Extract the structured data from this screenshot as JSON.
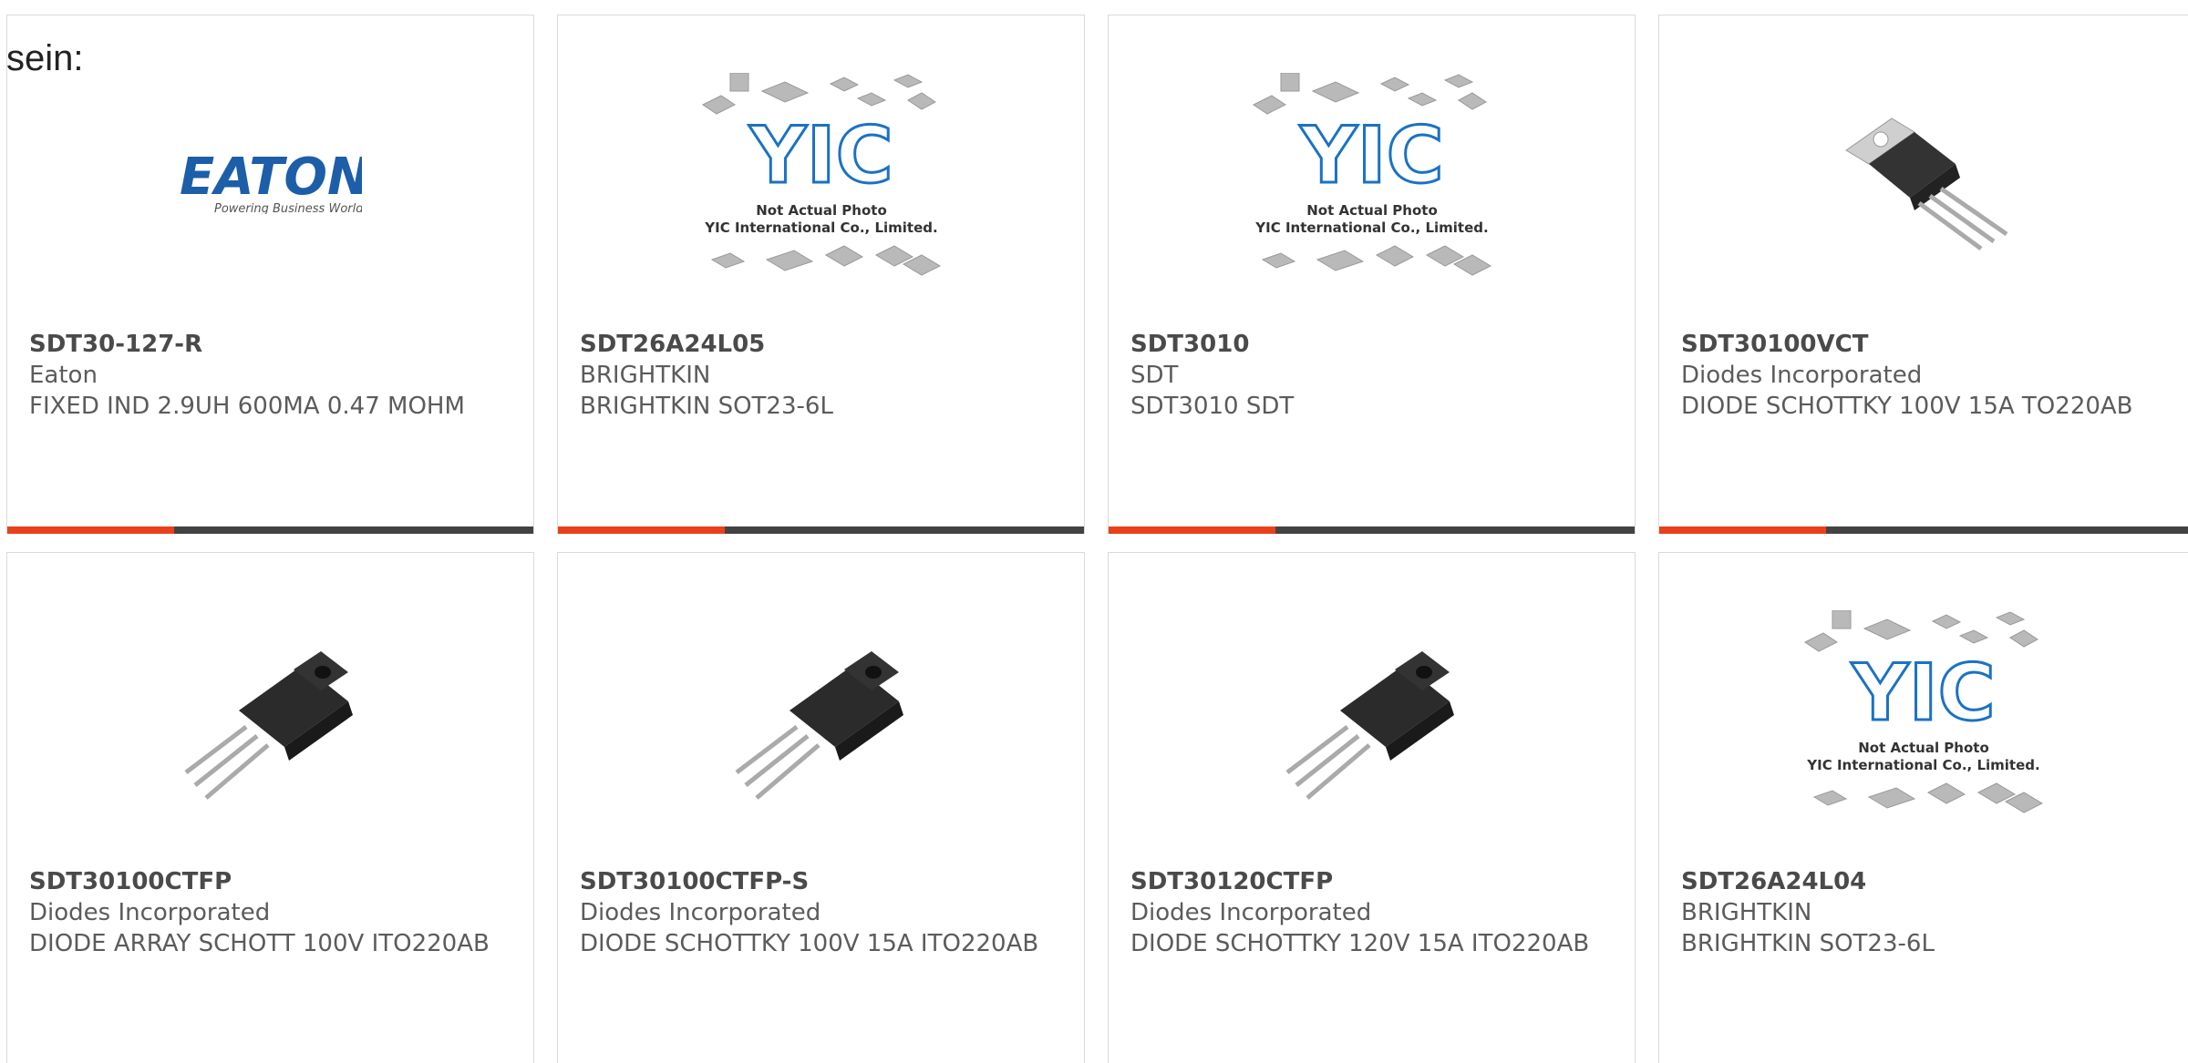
{
  "prefix_text": "sein:",
  "colors": {
    "accent": "#e8411b",
    "bar": "#434343",
    "text": "#5b5b5b"
  },
  "placeholder": {
    "line1": "Not Actual Photo",
    "line2": "YIC International Co., Limited.",
    "logo": "YIC"
  },
  "eaton": {
    "logo": "EATON",
    "tagline": "Powering Business Worldwide"
  },
  "cards": [
    {
      "part": "SDT30-127-R",
      "mfr": "Eaton",
      "desc": "FIXED IND 2.9UH 600MA 0.47 MOHM",
      "image": "eaton-logo"
    },
    {
      "part": "SDT26A24L05",
      "mfr": "BRIGHTKIN",
      "desc": "BRIGHTKIN SOT23-6L",
      "image": "not-actual-photo"
    },
    {
      "part": "SDT3010",
      "mfr": "SDT",
      "desc": "SDT3010 SDT",
      "image": "not-actual-photo"
    },
    {
      "part": "SDT30100VCT",
      "mfr": "Diodes Incorporated",
      "desc": "DIODE SCHOTTKY 100V 15A TO220AB",
      "image": "to220-package"
    },
    {
      "part": "SDT30100CTFP",
      "mfr": "Diodes Incorporated",
      "desc": "DIODE ARRAY SCHOTT 100V ITO220AB",
      "image": "ito220-package"
    },
    {
      "part": "SDT30100CTFP-S",
      "mfr": "Diodes Incorporated",
      "desc": "DIODE SCHOTTKY 100V 15A ITO220AB",
      "image": "ito220-package"
    },
    {
      "part": "SDT30120CTFP",
      "mfr": "Diodes Incorporated",
      "desc": "DIODE SCHOTTKY 120V 15A ITO220AB",
      "image": "ito220-package"
    },
    {
      "part": "SDT26A24L04",
      "mfr": "BRIGHTKIN",
      "desc": "BRIGHTKIN SOT23-6L",
      "image": "not-actual-photo"
    }
  ]
}
